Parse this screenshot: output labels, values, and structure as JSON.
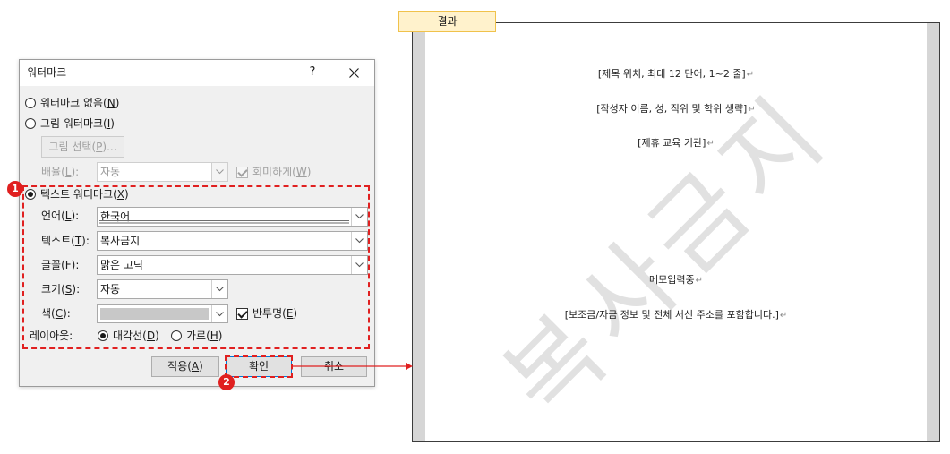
{
  "colors": {
    "annotation_red": "#e02020",
    "result_label_bg": "#fff2cc",
    "result_label_border": "#f0c24b",
    "watermark": "#e1e1e1",
    "page_margin": "#d6d6d6",
    "default_button_border": "#0078d7"
  },
  "icons": {
    "close": "close-icon",
    "dropdown": "chevron-down-icon",
    "connector": "arrow-right-icon"
  },
  "dialog": {
    "title": "워터마크",
    "help_label": "?",
    "no_watermark": {
      "label": "워터마크 없음(N)",
      "selected": false
    },
    "picture_watermark": {
      "label": "그림 워터마크(I)",
      "selected": false
    },
    "select_picture_button": "그림 선택(P)...",
    "scale": {
      "label": "배율(L):",
      "value": "자동"
    },
    "washout": {
      "label": "회미하게(W)",
      "checked": true
    },
    "text_watermark": {
      "label": "텍스트 워터마크(X)",
      "selected": true
    },
    "language": {
      "label": "언어(L):",
      "value": "한국어"
    },
    "text": {
      "label": "텍스트(T):",
      "value": "복사금지"
    },
    "font": {
      "label": "글꼴(F):",
      "value": "맑은 고딕"
    },
    "size": {
      "label": "크기(S):",
      "value": "자동"
    },
    "color": {
      "label": "색(C):",
      "swatch": "#c8c8c8"
    },
    "semitransparent": {
      "label": "반투명(E)",
      "checked": true
    },
    "layout": {
      "label": "레이아웃:",
      "options": [
        {
          "label": "대각선(D)",
          "selected": true
        },
        {
          "label": "가로(H)",
          "selected": false
        }
      ]
    },
    "buttons": {
      "apply": "적용(A)",
      "ok": "확인",
      "cancel": "취소"
    }
  },
  "annotations": {
    "step_1": "1",
    "step_2": "2"
  },
  "result": {
    "label": "결과",
    "lines": [
      "[제목 위치, 최대 12 단어, 1~2 줄]",
      "[작성자 이름, 성, 직위 및 학위 생략]",
      "[제휴 교육 기관]",
      "메모입력중",
      "[보조금/자금 정보 및 전체 서신 주소를 포함합니다.]"
    ],
    "paragraph_mark": "↵",
    "watermark_text": "복사금지"
  }
}
